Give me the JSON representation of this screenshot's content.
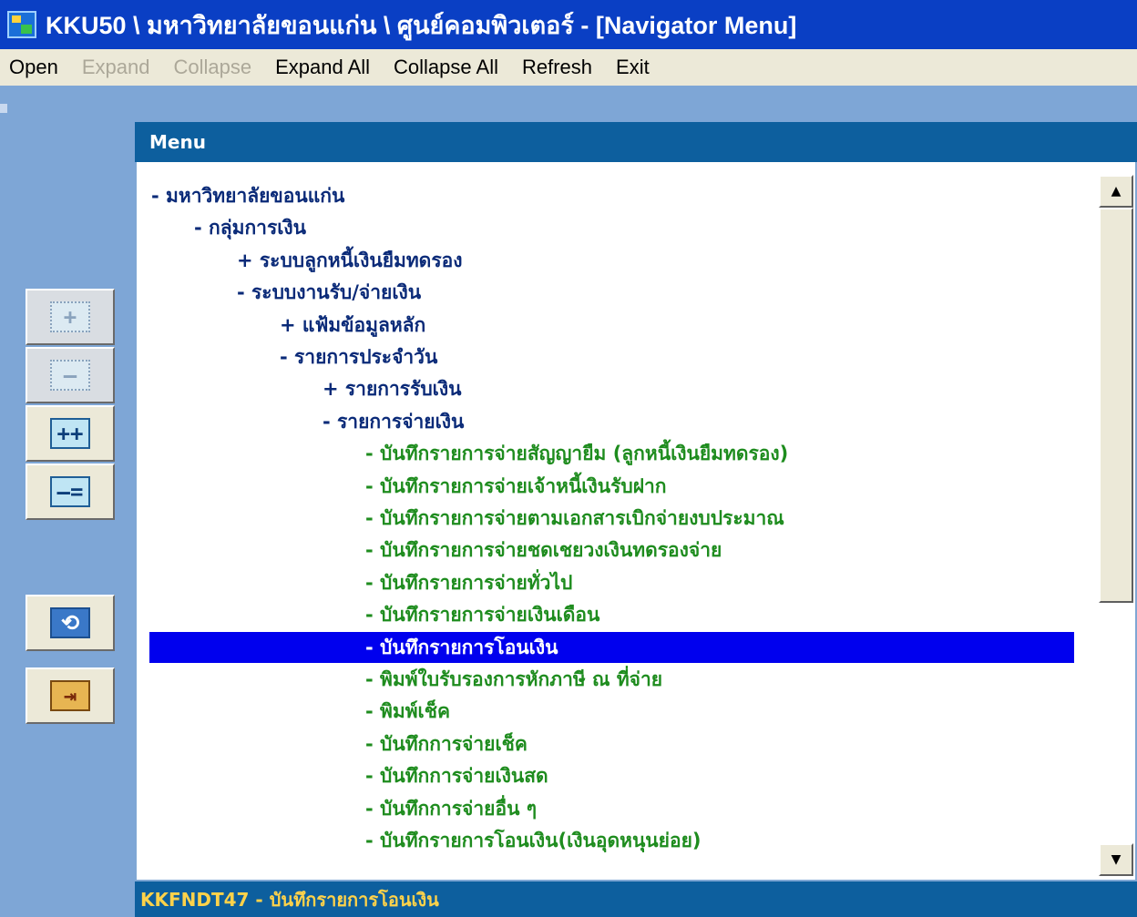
{
  "window": {
    "title": "KKU50 \\ มหาวิทยาลัยขอนแก่น \\ ศูนย์คอมพิวเตอร์ - [Navigator Menu]",
    "icon": "app-icon"
  },
  "menubar": {
    "items": [
      {
        "label": "Open",
        "enabled": true
      },
      {
        "label": "Expand",
        "enabled": false
      },
      {
        "label": "Collapse",
        "enabled": false
      },
      {
        "label": "Expand All",
        "enabled": true
      },
      {
        "label": "Collapse All",
        "enabled": true
      },
      {
        "label": "Refresh",
        "enabled": true
      },
      {
        "label": "Exit",
        "enabled": true
      }
    ]
  },
  "panel": {
    "header": "Menu",
    "status": "KKFNDT47 - บันทึกรายการโอนเงิน"
  },
  "toolbar": {
    "buttons": [
      {
        "name": "expand-button",
        "icon": "plus-icon",
        "glyph": "+",
        "enabled": false
      },
      {
        "name": "collapse-button",
        "icon": "minus-icon",
        "glyph": "—",
        "enabled": false
      },
      {
        "name": "expand-all-button",
        "icon": "plus-plus-icon",
        "glyph": "++",
        "enabled": true
      },
      {
        "name": "collapse-all-button",
        "icon": "minus-minus-icon",
        "glyph": "–=",
        "enabled": true
      },
      {
        "name": "refresh-button",
        "icon": "refresh-icon",
        "glyph": "⟲",
        "enabled": true
      },
      {
        "name": "exit-button",
        "icon": "exit-door-icon",
        "glyph": "⇥",
        "enabled": true
      }
    ]
  },
  "tree": {
    "items": [
      {
        "text": "- มหาวิทยาลัยขอนแก่น",
        "level": 0,
        "kind": "node"
      },
      {
        "text": "- กลุ่มการเงิน",
        "level": 1,
        "kind": "node"
      },
      {
        "text": "+ ระบบลูกหนี้เงินยืมทดรอง",
        "level": 2,
        "kind": "node"
      },
      {
        "text": "- ระบบงานรับ/จ่ายเงิน",
        "level": 2,
        "kind": "node"
      },
      {
        "text": "+ แฟ้มข้อมูลหลัก",
        "level": 3,
        "kind": "node"
      },
      {
        "text": "- รายการประจำวัน",
        "level": 3,
        "kind": "node"
      },
      {
        "text": "+ รายการรับเงิน",
        "level": 4,
        "kind": "node"
      },
      {
        "text": "- รายการจ่ายเงิน",
        "level": 4,
        "kind": "node"
      },
      {
        "text": "- บันทึกรายการจ่ายสัญญายืม (ลูกหนี้เงินยืมทดรอง)",
        "level": 5,
        "kind": "leaf"
      },
      {
        "text": "- บันทึกรายการจ่ายเจ้าหนี้เงินรับฝาก",
        "level": 5,
        "kind": "leaf"
      },
      {
        "text": "- บันทึกรายการจ่ายตามเอกสารเบิกจ่ายงบประมาณ",
        "level": 5,
        "kind": "leaf"
      },
      {
        "text": "- บันทึกรายการจ่ายชดเชยวงเงินทดรองจ่าย",
        "level": 5,
        "kind": "leaf"
      },
      {
        "text": "- บันทึกรายการจ่ายทั่วไป",
        "level": 5,
        "kind": "leaf"
      },
      {
        "text": "- บันทึกรายการจ่ายเงินเดือน",
        "level": 5,
        "kind": "leaf"
      },
      {
        "text": "- บันทึกรายการโอนเงิน",
        "level": 5,
        "kind": "leaf",
        "selected": true
      },
      {
        "text": "- พิมพ์ใบรับรองการหักภาษี ณ ที่จ่าย",
        "level": 5,
        "kind": "leaf"
      },
      {
        "text": "- พิมพ์เช็ค",
        "level": 5,
        "kind": "leaf"
      },
      {
        "text": "- บันทึกการจ่ายเช็ค",
        "level": 5,
        "kind": "leaf"
      },
      {
        "text": "- บันทึกการจ่ายเงินสด",
        "level": 5,
        "kind": "leaf"
      },
      {
        "text": "- บันทึกการจ่ายอื่น ๆ",
        "level": 5,
        "kind": "leaf"
      },
      {
        "text": "- บันทึกรายการโอนเงิน(เงินอุดหนุนย่อย)",
        "level": 5,
        "kind": "leaf"
      }
    ]
  },
  "colors": {
    "title_bar": "#0a3fc4",
    "panel_header": "#0d5f9e",
    "node_text": "#0a2a78",
    "leaf_text": "#1e8c1e",
    "selection": "#0000ee",
    "status_text": "#ffd24a"
  }
}
